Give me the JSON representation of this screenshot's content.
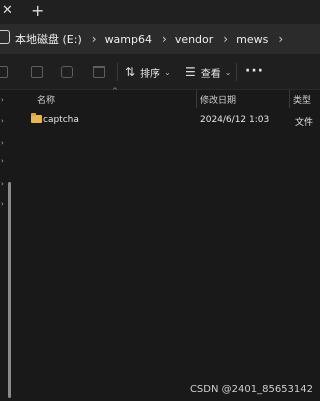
{
  "tabs": {
    "close_glyph": "✕",
    "new_glyph": "+"
  },
  "address": {
    "breadcrumbs": [
      "本地磁盘 (E:)",
      "wamp64",
      "vendor",
      "mews"
    ],
    "chevron_glyph": "›"
  },
  "toolbar": {
    "sort_label": "排序",
    "sort_glyph": "⇅",
    "view_label": "查看",
    "view_glyph": "☰",
    "caret_glyph": "⌄",
    "more_glyph": "···"
  },
  "columns": {
    "name": "名称",
    "date": "修改日期",
    "type": "类型",
    "sort_caret": "^"
  },
  "files": [
    {
      "name": "captcha",
      "modified": "2024/6/12 1:03",
      "type": "文件"
    }
  ],
  "nav": {
    "chevron_glyph": "›"
  },
  "watermark": "CSDN @2401_85653142",
  "colors": {
    "background": "#191919",
    "address_bar": "#2b2b2b",
    "folder": "#e8b84a"
  }
}
